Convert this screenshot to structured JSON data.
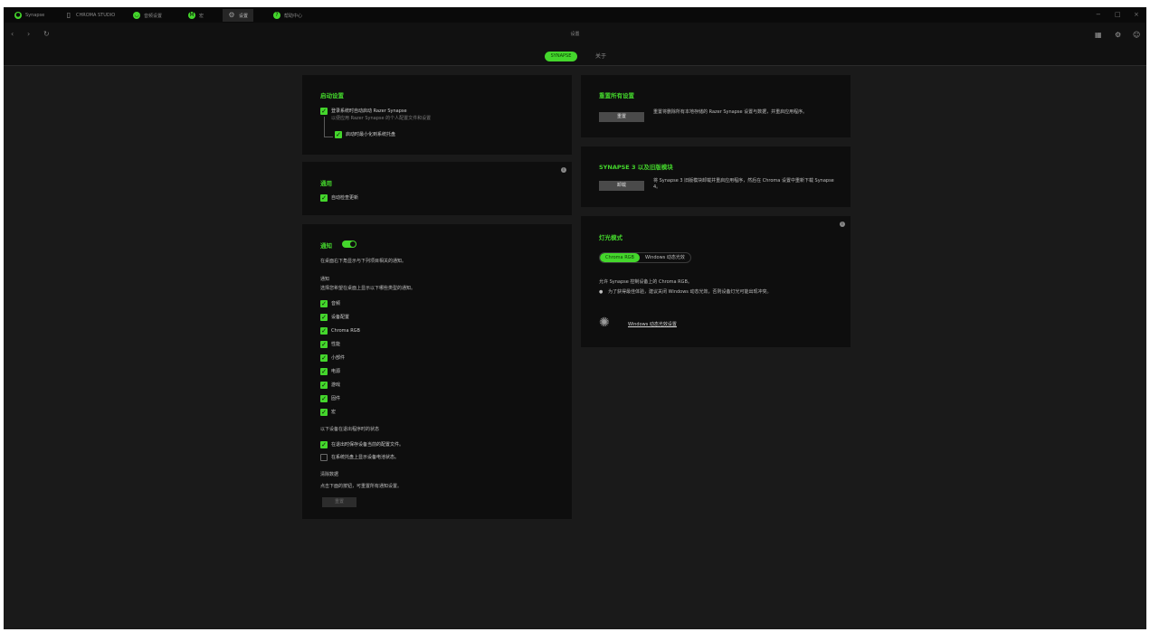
{
  "tabs": [
    {
      "label": "Synapse",
      "icon": "razer-icon"
    },
    {
      "label": "CHROMA STUDIO",
      "icon": "document-icon"
    },
    {
      "label": "音频设置",
      "icon": "headset-icon"
    },
    {
      "label": "宏",
      "icon": "macro-icon"
    },
    {
      "label": "设置",
      "icon": "gear-icon"
    },
    {
      "label": "帮助中心",
      "icon": "help-icon"
    }
  ],
  "nav": {
    "back": "‹",
    "forward": "›",
    "refresh": "↻",
    "title": "设置"
  },
  "window_controls": {
    "minimize": "−",
    "maximize": "□",
    "close": "×"
  },
  "nav_right": {
    "grid": "▦",
    "settings": "⚙",
    "profile": "☺"
  },
  "subtabs": {
    "active": "SYNAPSE",
    "other": "关于"
  },
  "startup": {
    "heading": "启动设置",
    "option1": "登录系统时自动启动 Razer Synapse",
    "option1_desc": "以便应用 Razer Synapse 的个人配置文件和设置",
    "option2": "启动时最小化到系统托盘"
  },
  "general": {
    "heading": "通用",
    "option1": "自动检查更新",
    "info": "i"
  },
  "notifications": {
    "heading": "通知",
    "desc": "在桌面右下角显示与下列项目相关的通知。",
    "sub_heading": "通知",
    "sub_desc": "选择您希望在桌面上显示以下哪些类型的通知。",
    "items": [
      "音频",
      "设备配置",
      "Chroma RGB",
      "性能",
      "小部件",
      "电源",
      "游戏",
      "固件",
      "宏"
    ],
    "section2_heading": "以下设备在退出程序时的状态",
    "section2_items": [
      {
        "label": "在退出时保存设备当前的配置文件。",
        "checked": true
      },
      {
        "label": "在系统托盘上显示设备电池状态。",
        "checked": false
      }
    ],
    "section3_heading": "清除数据",
    "section3_desc": "点击下面的按钮，可重置所有通知设置。",
    "section3_button": "重置"
  },
  "reset_card": {
    "heading": "重置所有设置",
    "button": "重置",
    "desc": "重置将删除所有本地存储的 Razer Synapse 设置与数据，并重启应用程序。"
  },
  "synapse3_card": {
    "heading": "SYNAPSE 3 以及旧版模块",
    "button": "卸载",
    "desc": "将 Synapse 3 旧版模块卸载并重启应用程序，然后在 Chroma 设置中重新下载 Synapse 4。"
  },
  "lighting_card": {
    "heading": "灯光模式",
    "info": "i",
    "seg_on": "Chroma RGB",
    "seg_off": "Windows 动态光效",
    "desc": "允许 Synapse 控制设备上的 Chroma RGB。",
    "bullet": "为了获得最佳体验，建议关闭 Windows 动态光效，否则设备灯光可能出现冲突。",
    "link": "Windows 动态光效设置"
  }
}
